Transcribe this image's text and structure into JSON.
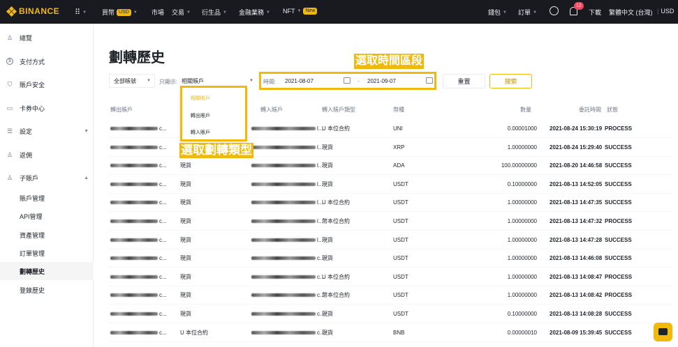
{
  "topbar": {
    "logo": "BINANCE",
    "nav": [
      "買幣",
      "市場",
      "交易",
      "衍生品",
      "金融業務",
      "NFT"
    ],
    "buy_badge": "USD",
    "nft_badge": "New",
    "right": {
      "wallet": "錢包",
      "orders": "訂單",
      "notif_count": "12",
      "download": "下載",
      "language": "繁體中文 (台灣)",
      "divider": "|",
      "currency": "USD"
    }
  },
  "sidebar": {
    "items": [
      {
        "label": "總覽",
        "icon": "person-icon"
      },
      {
        "label": "支付方式",
        "icon": "dollar-circle-icon"
      },
      {
        "label": "賬戶安全",
        "icon": "shield-icon"
      },
      {
        "label": "卡券中心",
        "icon": "ticket-icon"
      },
      {
        "label": "設定",
        "icon": "sliders-icon"
      },
      {
        "label": "返佣",
        "icon": "add-user-icon"
      },
      {
        "label": "子賬戶",
        "icon": "sub-account-icon"
      }
    ],
    "sub_items": [
      "賬戶管理",
      "API管理",
      "資產管理",
      "訂單管理",
      "劃轉歷史",
      "登錄歷史"
    ],
    "active": "劃轉歷史"
  },
  "main": {
    "title": "劃轉歷史",
    "account_filter": "全部帳號",
    "show_label": "只顯示:",
    "show_value": "相關賬戶",
    "time_label": "時間:",
    "date_from": "2021-08-07",
    "date_sep": "-",
    "date_to": "2021-09-07",
    "reset": "重置",
    "search": "搜索",
    "dropdown": [
      "相關賬戶",
      "轉出賬戶",
      "轉入賬戶"
    ],
    "annot_time": "選取時間區段",
    "annot_type": "選取劃轉類型",
    "columns": [
      "轉出賬戶",
      "轉出賬戶類型",
      "轉入賬戶",
      "轉入賬戶類型",
      "幣種",
      "數量",
      "委託時間",
      "狀態"
    ]
  },
  "rows": [
    {
      "from": "c...",
      "from_type": "",
      "to": "l...",
      "to_type": "U 本位合約",
      "coin": "UNI",
      "amount": "0.00001000",
      "time": "2021-08-24 15:30:19",
      "status": "PROCESS"
    },
    {
      "from": "c...",
      "from_type": "",
      "to": "l...",
      "to_type": "現貨",
      "coin": "XRP",
      "amount": "1.00000000",
      "time": "2021-08-24 15:29:40",
      "status": "SUCCESS"
    },
    {
      "from": "c...",
      "from_type": "現貨",
      "to": "l...",
      "to_type": "現貨",
      "coin": "ADA",
      "amount": "100.00000000",
      "time": "2021-08-20 14:46:58",
      "status": "SUCCESS"
    },
    {
      "from": "c...",
      "from_type": "現貨",
      "to": "l...",
      "to_type": "現貨",
      "coin": "USDT",
      "amount": "0.10000000",
      "time": "2021-08-13 14:52:05",
      "status": "SUCCESS"
    },
    {
      "from": "c...",
      "from_type": "現貨",
      "to": "l...",
      "to_type": "U 本位合約",
      "coin": "USDT",
      "amount": "1.00000000",
      "time": "2021-08-13 14:47:35",
      "status": "SUCCESS"
    },
    {
      "from": "c...",
      "from_type": "現貨",
      "to": "l...",
      "to_type": "幣本位合約",
      "coin": "USDT",
      "amount": "1.00000000",
      "time": "2021-08-13 14:47:32",
      "status": "PROCESS"
    },
    {
      "from": "c...",
      "from_type": "現貨",
      "to": "l...",
      "to_type": "現貨",
      "coin": "USDT",
      "amount": "1.00000000",
      "time": "2021-08-13 14:47:28",
      "status": "SUCCESS"
    },
    {
      "from": "c...",
      "from_type": "現貨",
      "to": "c...",
      "to_type": "現貨",
      "coin": "USDT",
      "amount": "1.00000000",
      "time": "2021-08-13 14:46:08",
      "status": "SUCCESS"
    },
    {
      "from": "c...",
      "from_type": "現貨",
      "to": "c...",
      "to_type": "U 本位合約",
      "coin": "USDT",
      "amount": "1.00000000",
      "time": "2021-08-13 14:08:47",
      "status": "PROCESS"
    },
    {
      "from": "c...",
      "from_type": "現貨",
      "to": "c...",
      "to_type": "幣本位合約",
      "coin": "USDT",
      "amount": "1.00000000",
      "time": "2021-08-13 14:08:42",
      "status": "PROCESS"
    },
    {
      "from": "c...",
      "from_type": "現貨",
      "to": "c...",
      "to_type": "現貨",
      "coin": "USDT",
      "amount": "0.10000000",
      "time": "2021-08-13 14:08:28",
      "status": "SUCCESS"
    },
    {
      "from": "c...",
      "from_type": "U 本位合約",
      "to": "c...",
      "to_type": "現貨",
      "coin": "BNB",
      "amount": "0.00000010",
      "time": "2021-08-09 15:39:45",
      "status": "SUCCESS"
    }
  ]
}
